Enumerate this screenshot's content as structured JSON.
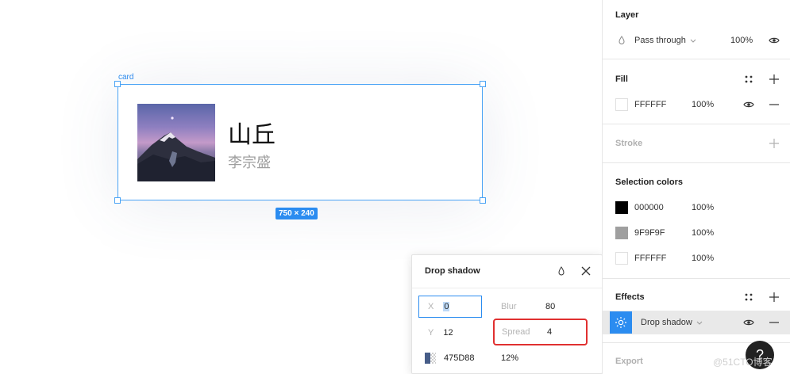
{
  "canvas": {
    "frame_label": "card",
    "card_title": "山丘",
    "card_subtitle": "李宗盛",
    "size_badge": "750 × 240"
  },
  "drop_shadow_popup": {
    "title": "Drop shadow",
    "x_label": "X",
    "x_value": "0",
    "blur_label": "Blur",
    "blur_value": "80",
    "y_label": "Y",
    "y_value": "12",
    "spread_label": "Spread",
    "spread_value": "4",
    "color_hex": "475D88",
    "color_opacity": "12%",
    "color": "#475d88"
  },
  "panel": {
    "layer": {
      "title": "Layer",
      "blend_mode": "Pass through",
      "opacity": "100%"
    },
    "fill": {
      "title": "Fill",
      "hex": "FFFFFF",
      "opacity": "100%",
      "color": "#ffffff"
    },
    "stroke": {
      "title": "Stroke"
    },
    "selection_colors": {
      "title": "Selection colors",
      "items": [
        {
          "hex": "000000",
          "opacity": "100%",
          "color": "#000000"
        },
        {
          "hex": "9F9F9F",
          "opacity": "100%",
          "color": "#9f9f9f"
        },
        {
          "hex": "FFFFFF",
          "opacity": "100%",
          "color": "#ffffff"
        }
      ]
    },
    "effects": {
      "title": "Effects",
      "item": "Drop shadow"
    },
    "export": {
      "title": "Export"
    }
  },
  "help_label": "?",
  "watermark": "@51CTO博客",
  "icons": [
    "drop-icon",
    "chevron-down-icon",
    "eye-icon",
    "style-grid-icon",
    "plus-icon",
    "minus-icon",
    "close-icon",
    "sun-icon",
    "help-icon"
  ]
}
